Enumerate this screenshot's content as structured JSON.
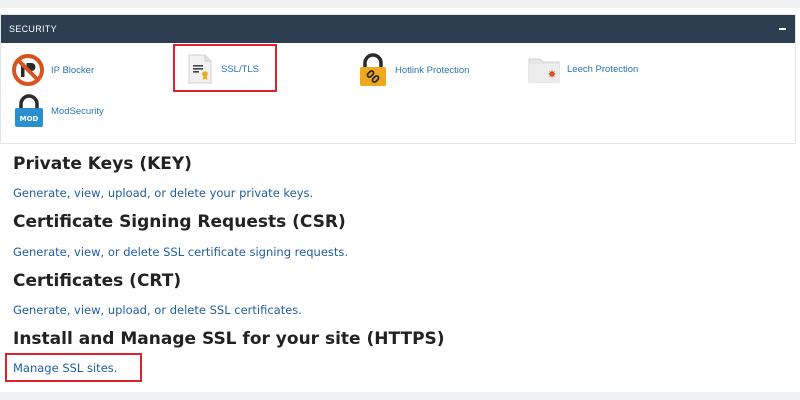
{
  "security_panel": {
    "title": "SECURITY",
    "items": [
      {
        "label": "IP Blocker",
        "icon": "ip-blocker-icon"
      },
      {
        "label": "SSL/TLS",
        "icon": "ssl-certificate-icon"
      },
      {
        "label": "Hotlink Protection",
        "icon": "hotlink-lock-icon"
      },
      {
        "label": "Leech Protection",
        "icon": "leech-folder-icon"
      },
      {
        "label": "ModSecurity",
        "icon": "modsecurity-lock-icon",
        "badge": "MOD"
      }
    ]
  },
  "sections": [
    {
      "heading": "Private Keys (KEY)",
      "link": "Generate, view, upload, or delete your private keys."
    },
    {
      "heading": "Certificate Signing Requests (CSR)",
      "link": "Generate, view, or delete SSL certificate signing requests."
    },
    {
      "heading": "Certificates (CRT)",
      "link": "Generate, view, upload, or delete SSL certificates."
    },
    {
      "heading": "Install and Manage SSL for your site (HTTPS)",
      "link": "Manage SSL sites."
    }
  ],
  "colors": {
    "header_bg": "#2c3e50",
    "link": "#1f5e9e",
    "highlight": "#e0202a",
    "ip_blocker": "#d9531e",
    "lock_body": "#f0a81c",
    "mod_badge": "#2a8ecf"
  }
}
